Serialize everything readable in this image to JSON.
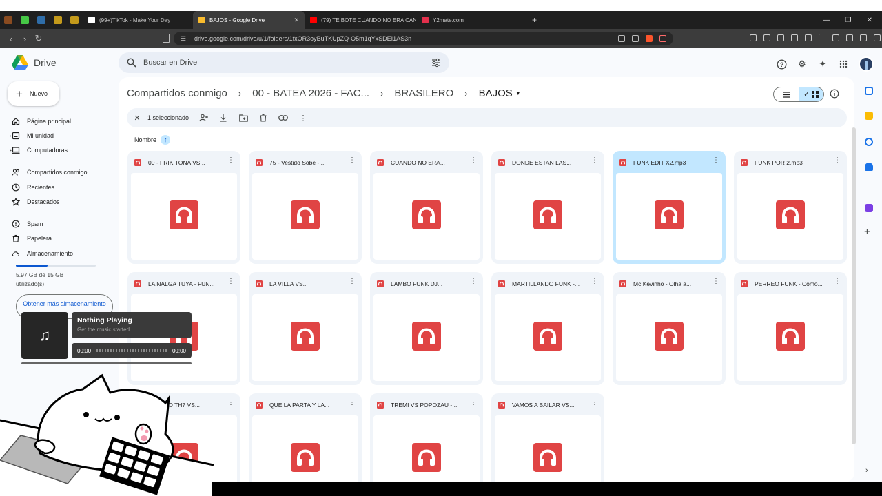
{
  "browser": {
    "tabs": [
      {
        "label": "(99+)TikTok - Make Your Day",
        "icon": "tiktok-icon",
        "active": false
      },
      {
        "label": "BAJOS - Google Drive",
        "icon": "google-drive-icon",
        "active": true
      },
      {
        "label": "(79) TE BOTE CUANDO NO ERA CAN",
        "icon": "youtube-icon",
        "active": false
      },
      {
        "label": "Y2mate.com",
        "icon": "y2mate-icon",
        "active": false
      }
    ],
    "new_tab": "+",
    "url": "drive.google.com/drive/u/1/folders/1fxOR3oyBuTKUpZQ-O5m1qYxSDEI1AS3n"
  },
  "drive": {
    "app_name": "Drive",
    "search_placeholder": "Buscar en Drive",
    "new_button": "Nuevo",
    "sidebar": {
      "items": [
        {
          "label": "Página principal",
          "icon": "home-icon"
        },
        {
          "label": "Mi unidad",
          "icon": "my-drive-icon"
        },
        {
          "label": "Computadoras",
          "icon": "computer-icon"
        },
        {
          "label": "Compartidos conmigo",
          "icon": "shared-icon"
        },
        {
          "label": "Recientes",
          "icon": "clock-icon"
        },
        {
          "label": "Destacados",
          "icon": "star-icon"
        },
        {
          "label": "Spam",
          "icon": "spam-icon"
        },
        {
          "label": "Papelera",
          "icon": "trash-icon"
        },
        {
          "label": "Almacenamiento",
          "icon": "cloud-icon"
        }
      ],
      "storage_text": "5.97 GB de 15 GB utilizado(s)",
      "storage_fraction": 0.398,
      "get_more": "Obtener más almacenamiento"
    },
    "breadcrumb": [
      "Compartidos conmigo",
      "00 - BATEA 2026 - FAC...",
      "BRASILERO",
      "BAJOS"
    ],
    "selection": {
      "label": "1 seleccionado"
    },
    "sort_label": "Nombre",
    "files": [
      {
        "name": "00 - FRIKITONA VS...",
        "selected": false
      },
      {
        "name": "75 - Vestido Sobe -...",
        "selected": false
      },
      {
        "name": "CUANDO NO ERA...",
        "selected": false
      },
      {
        "name": "DONDE ESTAN LAS...",
        "selected": false
      },
      {
        "name": "FUNK EDIT X2.mp3",
        "selected": true
      },
      {
        "name": "FUNK POR 2.mp3",
        "selected": false
      },
      {
        "name": "LA NALGA TUYA - FUN...",
        "selected": false
      },
      {
        "name": "LA VILLA VS...",
        "selected": false
      },
      {
        "name": "LAMBO FUNK DJ...",
        "selected": false
      },
      {
        "name": "MARTILLANDO FUNK -...",
        "selected": false
      },
      {
        "name": "Mc Kevinho - Olha a...",
        "selected": false
      },
      {
        "name": "PERREO FUNK - Como...",
        "selected": false
      },
      {
        "name": "PERREO TH7 VS...",
        "selected": false
      },
      {
        "name": "QUE LA PARTA Y LA...",
        "selected": false
      },
      {
        "name": "TREMI VS POPOZAU -...",
        "selected": false
      },
      {
        "name": "VAMOS A BAILAR VS...",
        "selected": false
      }
    ]
  },
  "player": {
    "title": "Nothing Playing",
    "subtitle": "Get the music started",
    "time_start": "00:00",
    "time_end": "00:00"
  },
  "colors": {
    "accent": "#0b57d0",
    "audio_red": "#e04444",
    "selected": "#c2e7ff"
  }
}
